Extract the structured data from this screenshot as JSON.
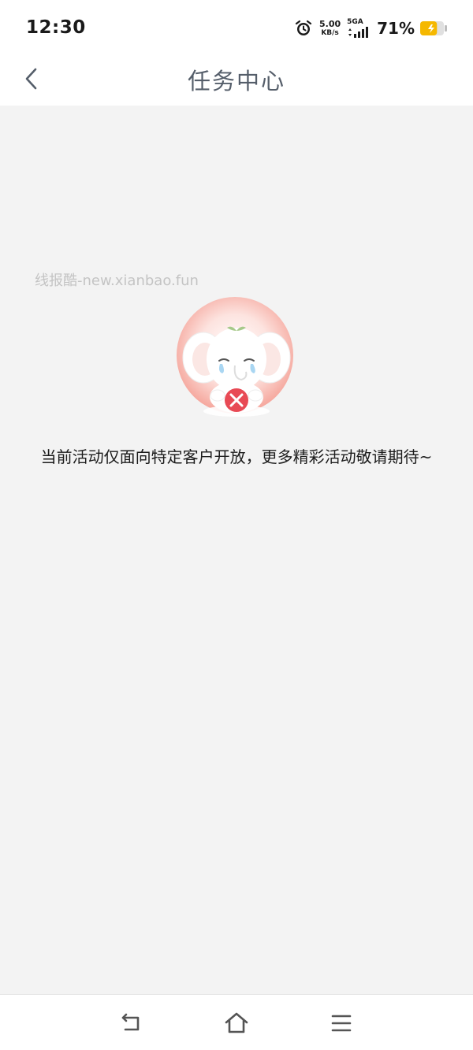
{
  "status_bar": {
    "time": "12:30",
    "net_speed_value": "5.00",
    "net_speed_unit": "KB/s",
    "network_type": "5GA",
    "battery_percent": "71%",
    "battery_level": 0.71,
    "battery_color": "#f5b800"
  },
  "nav": {
    "back_icon": "chevron-left-icon",
    "title": "任务中心"
  },
  "content": {
    "watermark": "线报酷-new.xianbao.fun",
    "mascot_icon": "crying-elephant-icon",
    "message": "当前活动仅面向特定客户开放，更多精彩活动敬请期待~"
  },
  "system_nav": {
    "back_icon": "back-arrow-icon",
    "home_icon": "home-icon",
    "menu_icon": "menu-icon"
  },
  "colors": {
    "background": "#f3f3f3",
    "title": "#555e6a",
    "error_red": "#e84a55"
  }
}
